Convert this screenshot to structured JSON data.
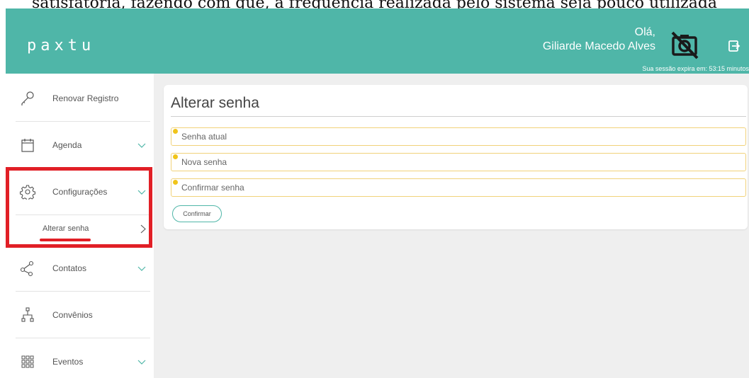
{
  "document": {
    "top_text": "satisfatória, fazendo com que, a frequência realizada pelo sistema seja pouco utilizada"
  },
  "header": {
    "logo": "paxtu",
    "greeting_line1": "Olá,",
    "greeting_line2": "Giliarde Macedo Alves",
    "session_text": "Sua sessão expira em: 53:15 minutos",
    "icons": [
      "camera-off-icon",
      "logout-icon"
    ]
  },
  "sidebar": {
    "items": [
      {
        "label": "Renovar Registro",
        "icon": "key-icon",
        "has_chevron": false
      },
      {
        "label": "Agenda",
        "icon": "calendar-icon",
        "has_chevron": true
      },
      {
        "label": "Configurações",
        "icon": "gear-icon",
        "has_chevron": true,
        "active": true
      },
      {
        "label": "Contatos",
        "icon": "share-icon",
        "has_chevron": true
      },
      {
        "label": "Convênios",
        "icon": "sitemap-icon",
        "has_chevron": false
      },
      {
        "label": "Eventos",
        "icon": "grid-icon",
        "has_chevron": true
      }
    ],
    "sub_item": {
      "label": "Alterar senha"
    }
  },
  "main": {
    "title": "Alterar senha",
    "fields": [
      {
        "placeholder": "Senha atual"
      },
      {
        "placeholder": "Nova senha"
      },
      {
        "placeholder": "Confirmar senha"
      }
    ],
    "confirm_label": "Confirmar"
  },
  "colors": {
    "header_bg": "#4fb6a8",
    "active_accent": "#61d0c5",
    "highlight": "#e11f26",
    "field_border": "#f1d27a",
    "warn_dot": "#f0c419"
  }
}
